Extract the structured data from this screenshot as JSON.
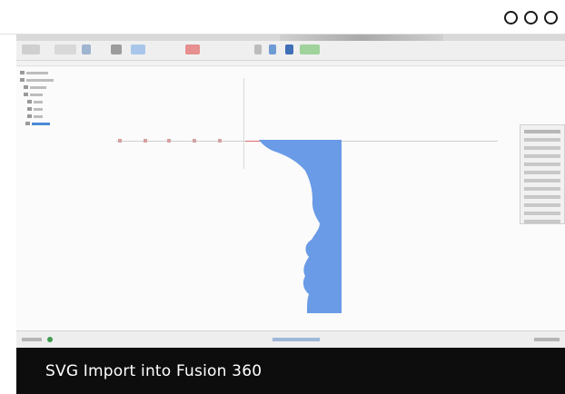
{
  "caption": {
    "text": "SVG Import into Fusion 360"
  },
  "colors": {
    "profile_fill": "#6a9be6",
    "caption_bg": "#0d0d0d",
    "caption_text": "#ffffff",
    "selection": "#4b8ad6",
    "origin_red": "#e06a6a"
  },
  "icons": {
    "window_controls": [
      "circle-icon",
      "circle-icon",
      "circle-icon"
    ],
    "imported_shape": "face-profile-icon"
  }
}
